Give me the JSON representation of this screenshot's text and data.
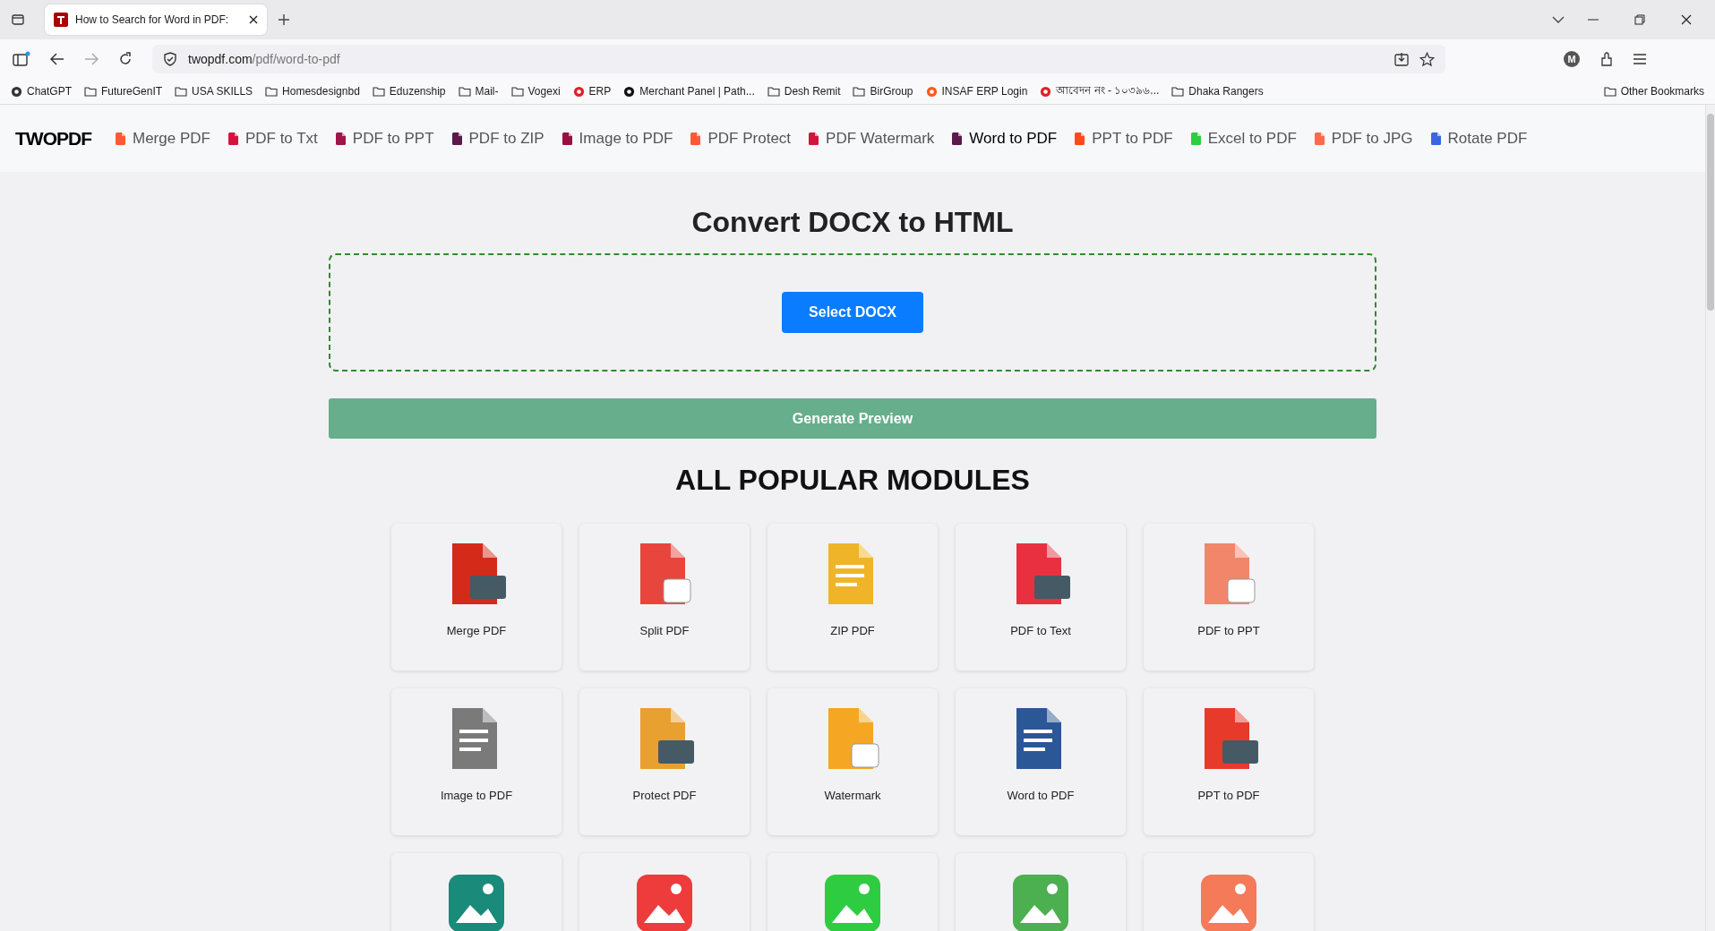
{
  "browser": {
    "tab": {
      "title": "How to Search for Word in PDF:"
    },
    "address": {
      "domain": "twopdf.com",
      "path": "/pdf/word-to-pdf"
    },
    "bookmarks": [
      {
        "label": "ChatGPT",
        "kind": "site"
      },
      {
        "label": "FutureGenIT",
        "kind": "folder"
      },
      {
        "label": "USA SKILLS",
        "kind": "folder"
      },
      {
        "label": "Homesdesignbd",
        "kind": "folder"
      },
      {
        "label": "Eduzenship",
        "kind": "folder"
      },
      {
        "label": "Mail-",
        "kind": "folder"
      },
      {
        "label": "Vogexi",
        "kind": "folder"
      },
      {
        "label": "ERP",
        "kind": "site"
      },
      {
        "label": "Merchant Panel | Path...",
        "kind": "site"
      },
      {
        "label": "Desh Remit",
        "kind": "folder"
      },
      {
        "label": "BirGroup",
        "kind": "folder"
      },
      {
        "label": "INSAF ERP Login",
        "kind": "site"
      },
      {
        "label": "আবেদন নং - ১০৩৯৬...",
        "kind": "site"
      },
      {
        "label": "Dhaka Rangers",
        "kind": "folder"
      }
    ],
    "other_bookmarks": "Other Bookmarks",
    "profile_initial": "M"
  },
  "site": {
    "logo": "TWOPDF",
    "nav": [
      {
        "label": "Merge PDF",
        "color": "#ff5a36",
        "selected": false
      },
      {
        "label": "PDF to Txt",
        "color": "#d4143c",
        "selected": false
      },
      {
        "label": "PDF to PPT",
        "color": "#a0154a",
        "selected": false
      },
      {
        "label": "PDF to ZIP",
        "color": "#5a1a4a",
        "selected": false
      },
      {
        "label": "Image to PDF",
        "color": "#9a1040",
        "selected": false
      },
      {
        "label": "PDF Protect",
        "color": "#ff5a36",
        "selected": false
      },
      {
        "label": "PDF Watermark",
        "color": "#d4143c",
        "selected": false
      },
      {
        "label": "Word to PDF",
        "color": "#5a1a4a",
        "selected": true
      },
      {
        "label": "PPT to PDF",
        "color": "#ff4a1a",
        "selected": false
      },
      {
        "label": "Excel to PDF",
        "color": "#2ecc40",
        "selected": false
      },
      {
        "label": "PDF to JPG",
        "color": "#ff6a4a",
        "selected": false
      },
      {
        "label": "Rotate PDF",
        "color": "#3a66e0",
        "selected": false
      }
    ],
    "heading": "Convert DOCX to HTML",
    "select_button": "Select DOCX",
    "preview_button": "Generate Preview",
    "modules_heading": "ALL POPULAR MODULES",
    "modules": [
      {
        "kind": "labeled",
        "label": "Merge PDF"
      },
      {
        "kind": "labeled",
        "label": "Split PDF"
      },
      {
        "kind": "labeled",
        "label": "ZIP PDF"
      },
      {
        "kind": "labeled",
        "label": "PDF to Text"
      },
      {
        "kind": "labeled",
        "label": "PDF to PPT"
      },
      {
        "kind": "labeled",
        "label": "Image to PDF"
      },
      {
        "kind": "labeled",
        "label": "Protect PDF"
      },
      {
        "kind": "labeled",
        "label": "Watermark"
      },
      {
        "kind": "labeled",
        "label": "Word to PDF"
      },
      {
        "kind": "labeled",
        "label": "PPT to PDF"
      },
      {
        "kind": "icon_only"
      },
      {
        "kind": "icon_only"
      },
      {
        "kind": "icon_only"
      },
      {
        "kind": "icon_only"
      },
      {
        "kind": "icon_only"
      }
    ]
  }
}
